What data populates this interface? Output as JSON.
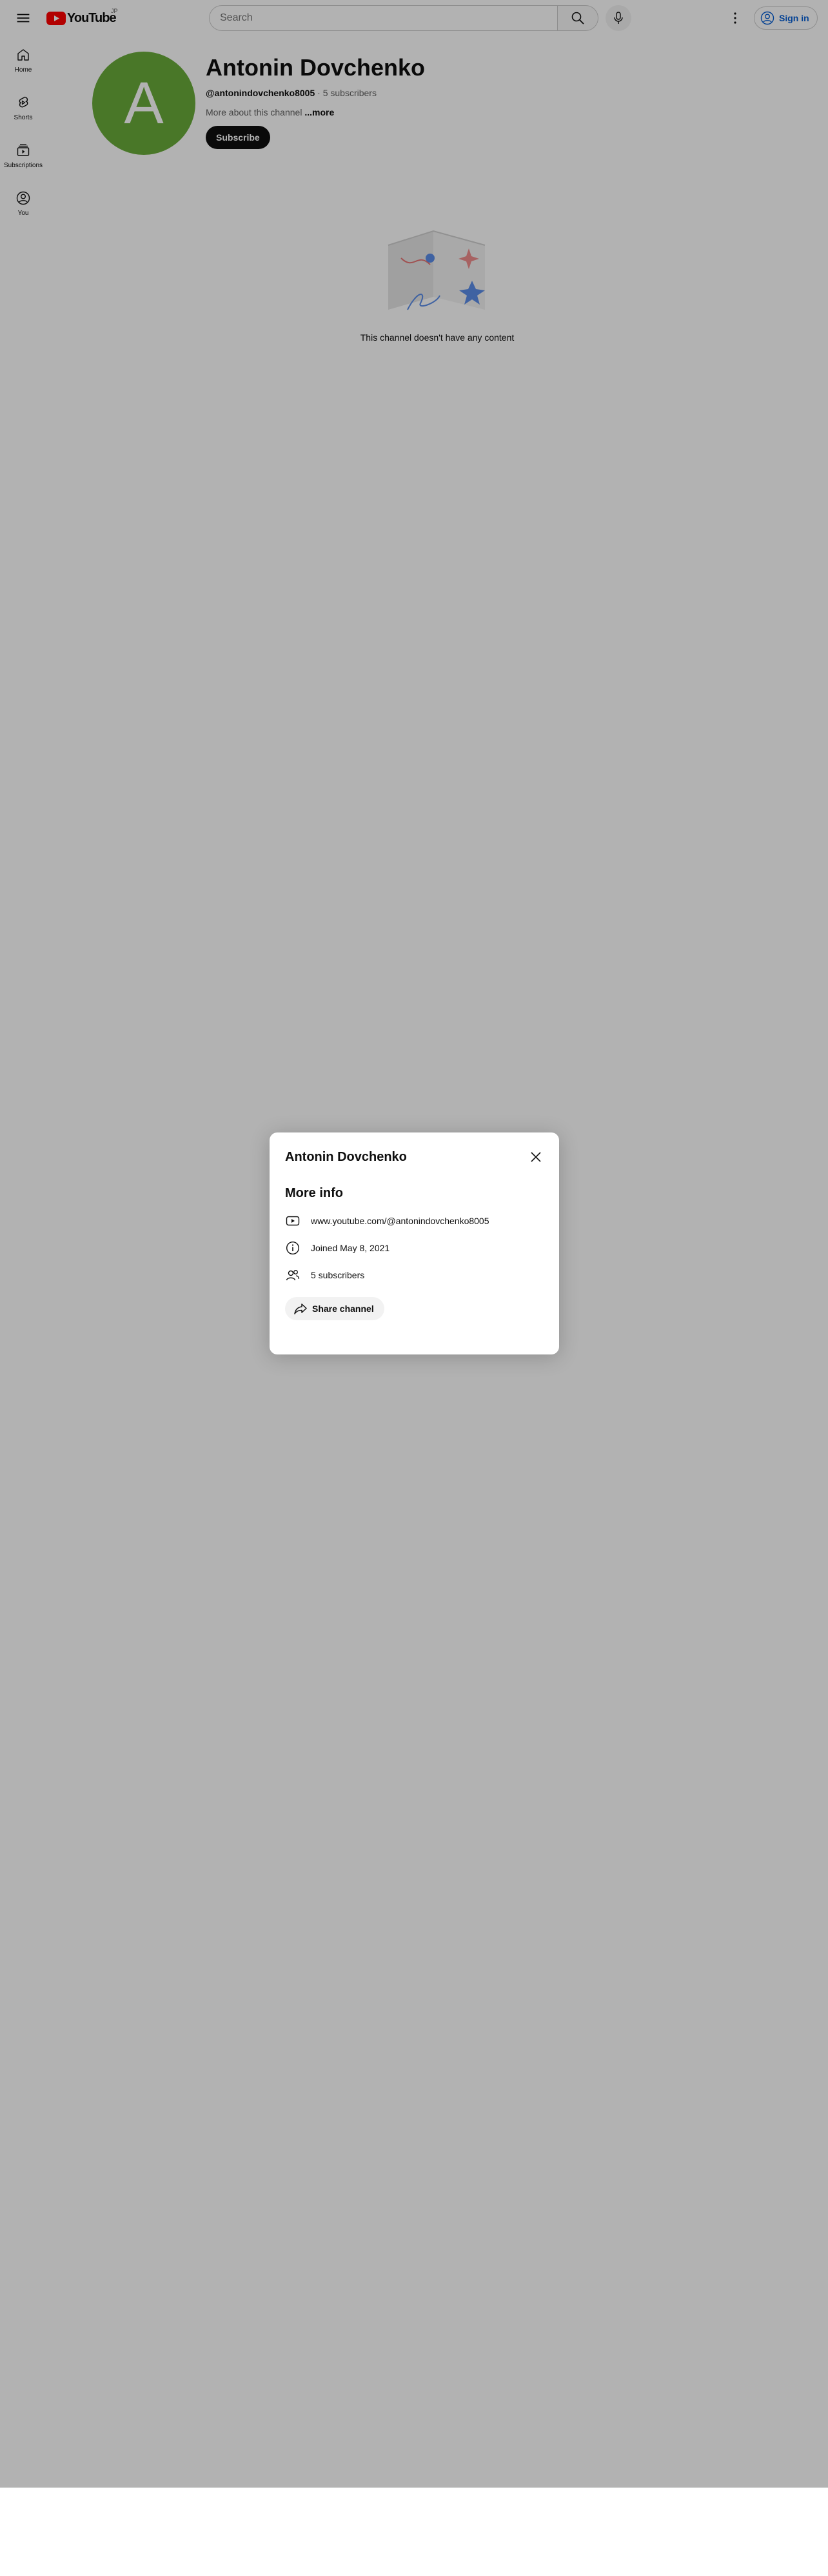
{
  "header": {
    "logo_text": "YouTube",
    "country_code": "JP",
    "search_placeholder": "Search",
    "signin_label": "Sign in",
    "accent_color": "#ff0000",
    "link_color": "#065fd4"
  },
  "guide": {
    "items": [
      {
        "label": "Home",
        "icon": "home-icon"
      },
      {
        "label": "Shorts",
        "icon": "shorts-icon"
      },
      {
        "label": "Subscriptions",
        "icon": "subscriptions-icon"
      },
      {
        "label": "You",
        "icon": "you-icon"
      }
    ]
  },
  "channel": {
    "avatar_letter": "A",
    "avatar_color": "#69ab3a",
    "name": "Antonin Dovchenko",
    "handle": "@antonindovchenko8005",
    "separator": " · ",
    "subscribers": "5 subscribers",
    "description": "More about this channel ",
    "more_label": "...more",
    "subscribe_label": "Subscribe"
  },
  "empty_state": {
    "message": "This channel doesn't have any content"
  },
  "about_dialog": {
    "title": "Antonin Dovchenko",
    "section_title": "More info",
    "rows": [
      {
        "icon": "youtube-play-icon",
        "text": "www.youtube.com/@antonindovchenko8005"
      },
      {
        "icon": "info-icon",
        "text": "Joined May 8, 2021"
      },
      {
        "icon": "people-icon",
        "text": "5 subscribers"
      }
    ],
    "share_label": "Share channel"
  }
}
